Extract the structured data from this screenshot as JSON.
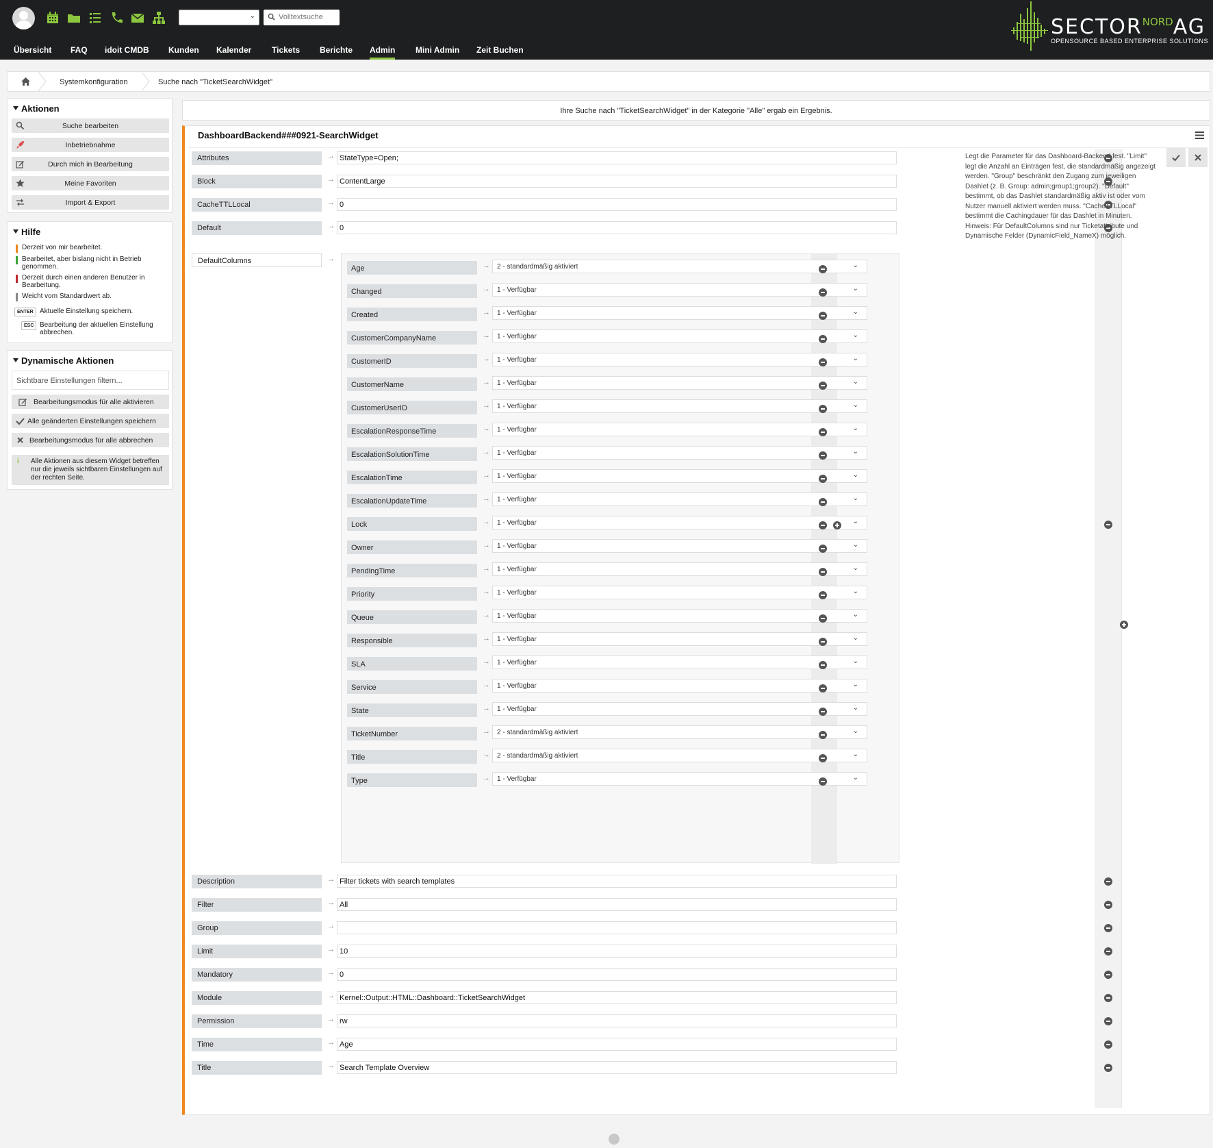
{
  "header": {
    "fulltext_placeholder": "Volltextsuche",
    "logo": {
      "main": "SECTOR",
      "nord": "NORD",
      "ag": "AG",
      "sub": "OPENSOURCE BASED ENTERPRISE SOLUTIONS"
    },
    "accent_color": "#8cc63f",
    "nav": [
      "Übersicht",
      "FAQ",
      "idoit CMDB",
      "Kunden",
      "Kalender",
      "Tickets",
      "Berichte",
      "Admin",
      "Mini Admin",
      "Zeit Buchen"
    ],
    "active_nav": "Admin",
    "icons": [
      "calendar-icon",
      "folder-icon",
      "list-icon",
      "phone-icon",
      "envelope-icon",
      "sitemap-icon"
    ]
  },
  "breadcrumb": {
    "items": [
      "Systemkonfiguration",
      "Suche nach \"TicketSearchWidget\""
    ]
  },
  "sidebar": {
    "actions_title": "Aktionen",
    "actions": [
      "Suche bearbeiten",
      "Inbetriebnahme",
      "Durch mich in Bearbeitung",
      "Meine Favoriten",
      "Import & Export"
    ],
    "help_title": "Hilfe",
    "help": [
      {
        "text": "Derzeit von mir bearbeitet.",
        "color": "#f0881f"
      },
      {
        "text": "Bearbeitet, aber bislang nicht in Betrieb genommen.",
        "color": "#3aa335"
      },
      {
        "text": "Derzeit durch einen anderen Benutzer in Bearbeitung.",
        "color": "#c0272d"
      },
      {
        "text": "Weicht vom Standardwert ab.",
        "color": "#888888"
      }
    ],
    "keys": [
      {
        "key": "ENTER",
        "text": "Aktuelle Einstellung speichern."
      },
      {
        "key": "ESC",
        "text": "Bearbeitung der aktuellen Einstellung abbrechen."
      }
    ],
    "dynamic_title": "Dynamische Aktionen",
    "filter_placeholder": "Sichtbare Einstellungen filtern...",
    "dynamic_actions": [
      "Bearbeitungsmodus für alle aktivieren",
      "Alle geänderten Einstellungen speichern",
      "Bearbeitungsmodus für alle abbrechen"
    ],
    "dynamic_info": "Alle Aktionen aus diesem Widget betreffen nur die jeweils sichtbaren Einstellungen auf der rechten Seite."
  },
  "result": {
    "text": "Ihre Suche nach \"TicketSearchWidget\" in der Kategorie \"Alle\" ergab ein Ergebnis."
  },
  "setting": {
    "title": "DashboardBackend###0921-SearchWidget",
    "rows_top": [
      {
        "key": "Attributes",
        "value": "StateType=Open;"
      },
      {
        "key": "Block",
        "value": "ContentLarge"
      },
      {
        "key": "CacheTTLLocal",
        "value": "0"
      },
      {
        "key": "Default",
        "value": "0"
      }
    ],
    "default_columns_key": "DefaultColumns",
    "default_columns": [
      {
        "key": "Age",
        "value": "2 - standardmäßig aktiviert"
      },
      {
        "key": "Changed",
        "value": "1 - Verfügbar"
      },
      {
        "key": "Created",
        "value": "1 - Verfügbar"
      },
      {
        "key": "CustomerCompanyName",
        "value": "1 - Verfügbar"
      },
      {
        "key": "CustomerID",
        "value": "1 - Verfügbar"
      },
      {
        "key": "CustomerName",
        "value": "1 - Verfügbar"
      },
      {
        "key": "CustomerUserID",
        "value": "1 - Verfügbar"
      },
      {
        "key": "EscalationResponseTime",
        "value": "1 - Verfügbar"
      },
      {
        "key": "EscalationSolutionTime",
        "value": "1 - Verfügbar"
      },
      {
        "key": "EscalationTime",
        "value": "1 - Verfügbar"
      },
      {
        "key": "EscalationUpdateTime",
        "value": "1 - Verfügbar"
      },
      {
        "key": "Lock",
        "value": "1 - Verfügbar"
      },
      {
        "key": "Owner",
        "value": "1 - Verfügbar"
      },
      {
        "key": "PendingTime",
        "value": "1 - Verfügbar"
      },
      {
        "key": "Priority",
        "value": "1 - Verfügbar"
      },
      {
        "key": "Queue",
        "value": "1 - Verfügbar"
      },
      {
        "key": "Responsible",
        "value": "1 - Verfügbar"
      },
      {
        "key": "SLA",
        "value": "1 - Verfügbar"
      },
      {
        "key": "Service",
        "value": "1 - Verfügbar"
      },
      {
        "key": "State",
        "value": "1 - Verfügbar"
      },
      {
        "key": "TicketNumber",
        "value": "2 - standardmäßig aktiviert"
      },
      {
        "key": "Title",
        "value": "2 - standardmäßig aktiviert"
      },
      {
        "key": "Type",
        "value": "1 - Verfügbar"
      }
    ],
    "rows_bottom": [
      {
        "key": "Description",
        "value": "Filter tickets with search templates"
      },
      {
        "key": "Filter",
        "value": "All"
      },
      {
        "key": "Group",
        "value": ""
      },
      {
        "key": "Limit",
        "value": "10"
      },
      {
        "key": "Mandatory",
        "value": "0"
      },
      {
        "key": "Module",
        "value": "Kernel::Output::HTML::Dashboard::TicketSearchWidget"
      },
      {
        "key": "Permission",
        "value": "rw"
      },
      {
        "key": "Time",
        "value": "Age"
      },
      {
        "key": "Title",
        "value": "Search Template Overview"
      }
    ],
    "description": "Legt die Parameter für das Dashboard-Backend fest. \"Limit\" legt die Anzahl an Einträgen fest, die standardmäßig angezeigt werden. \"Group\" beschränkt den Zugang zum jeweiligen Dashlet (z. B. Group: admin;group1;group2). \"Default\" bestimmt, ob das Dashlet standardmäßig aktiv ist oder vom Nutzer manuell aktiviert werden muss. \"CacheTTLLocal\" bestimmt die Cachingdauer für das Dashlet in Minuten. Hinweis: Für DefaultColumns sind nur Ticketattribute und Dynamische Felder (DynamicField_NameX) möglich.",
    "edit_color": "#f0881f"
  }
}
